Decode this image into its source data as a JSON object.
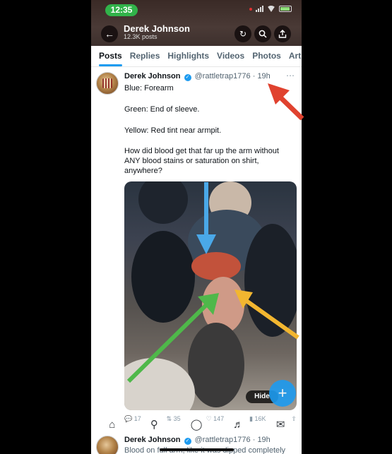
{
  "status_bar": {
    "time": "12:35"
  },
  "header": {
    "name": "Derek Johnson",
    "posts": "12.3K posts"
  },
  "tabs": [
    "Posts",
    "Replies",
    "Highlights",
    "Videos",
    "Photos",
    "Art"
  ],
  "tweet": {
    "name": "Derek Johnson",
    "handle": "@rattletrap1776",
    "time": "19h",
    "lines": [
      "Blue: Forearm",
      "Green: End of sleeve.",
      "Yellow: Red tint near armpit.",
      "How did blood get that far up the arm without",
      "ANY blood stains or saturation on shirt,",
      "anywhere?"
    ],
    "hide_label": "Hide",
    "replies": "17",
    "reposts": "35",
    "likes": "147",
    "views": "16K"
  },
  "next_tweet": {
    "name": "Derek Johnson",
    "handle": "@rattletrap1776",
    "time": "19h",
    "text": "Blood on full arm, like it was dipped completely"
  },
  "colors": {
    "blue_arrow": "#4aa8e8",
    "green_arrow": "#4fb84a",
    "yellow_arrow": "#f2b630",
    "red_arrow": "#e0422f",
    "accent": "#1d9bf0"
  }
}
